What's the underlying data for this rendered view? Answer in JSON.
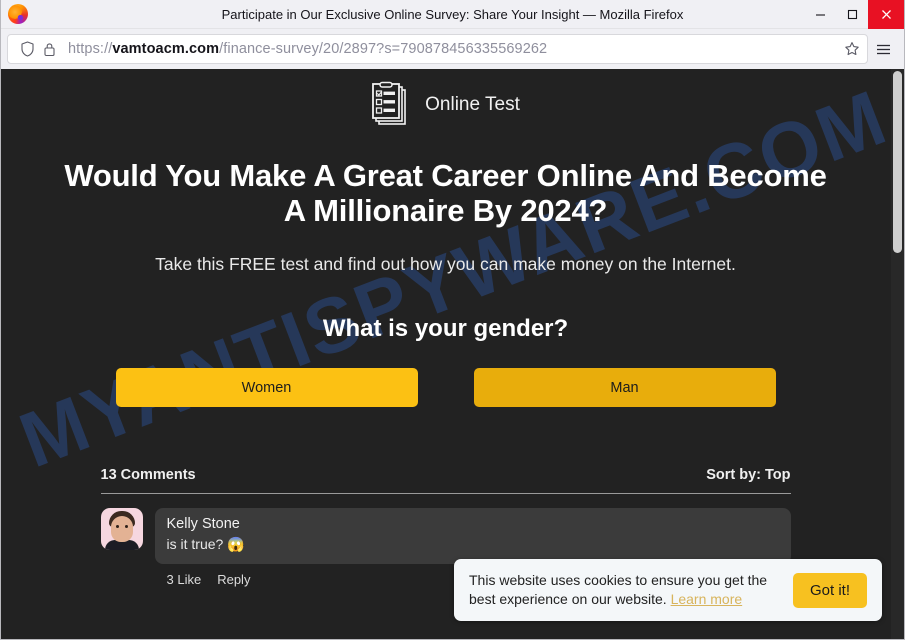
{
  "window": {
    "title": "Participate in Our Exclusive Online Survey: Share Your Insight — Mozilla Firefox",
    "minimize_label": "Minimize",
    "maximize_label": "Maximize",
    "close_label": "Close"
  },
  "navbar": {
    "url_scheme": "https://",
    "url_host": "vamtoacm.com",
    "url_path": "/finance-survey/20/2897?s=790878456335569262",
    "shield_icon": "shield-icon",
    "lock_icon": "padlock-icon",
    "bookmark_icon": "star-icon",
    "menu_icon": "hamburger-menu-icon"
  },
  "page": {
    "watermark": "MYANTISPYWARE.COM",
    "brand": {
      "icon": "checklist-document-icon",
      "name": "Online Test"
    },
    "headline": "Would You Make A Great Career Online And Become A Millionaire By 2024?",
    "subheadline": "Take this FREE test and find out how you can make money on the Internet.",
    "question": "What is your gender?",
    "answers": [
      {
        "label": "Women",
        "color": "#fcc113"
      },
      {
        "label": "Man",
        "color": "#e8ad0c"
      }
    ],
    "comments_section": {
      "count_label": "13 Comments",
      "sort_label": "Sort by: Top",
      "items": [
        {
          "author": "Kelly Stone",
          "text": "is it true? 😱",
          "likes_label": "3 Like",
          "reply_label": "Reply"
        }
      ]
    },
    "cookie_banner": {
      "message": "This website uses cookies to ensure you get the best experience on our website.",
      "link_label": "Learn more",
      "accept_label": "Got it!"
    }
  }
}
